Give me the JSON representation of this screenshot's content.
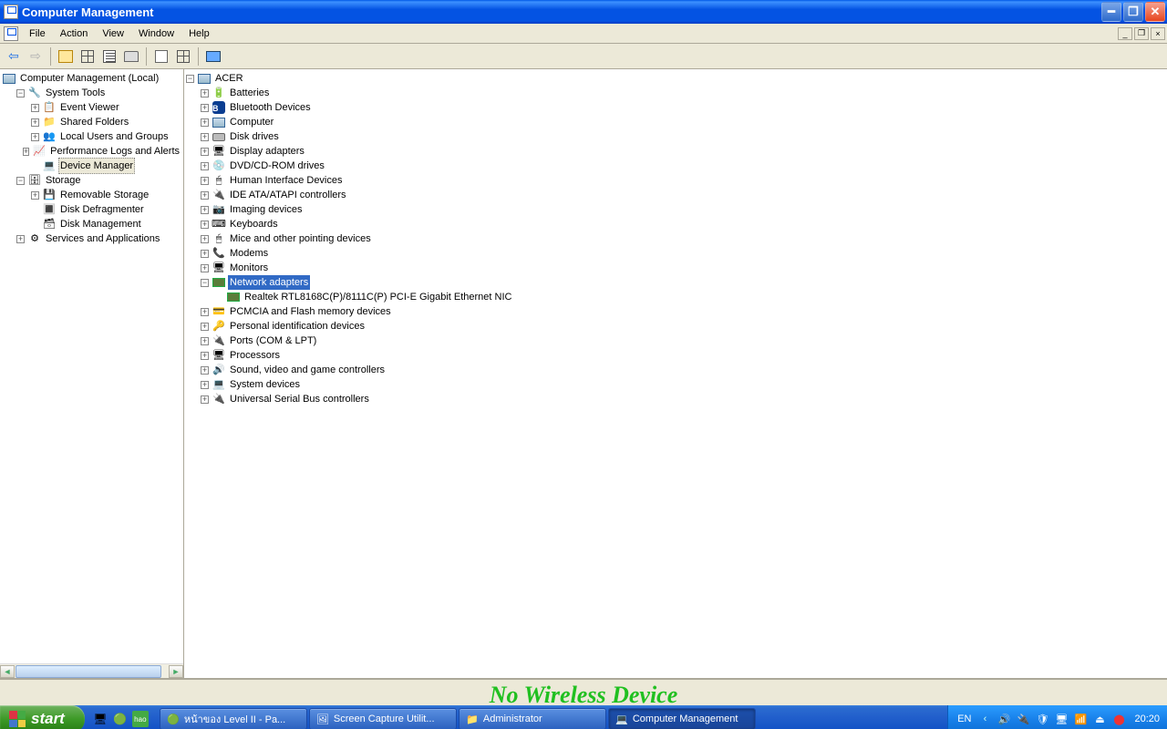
{
  "title": "Computer Management",
  "menu": [
    "File",
    "Action",
    "View",
    "Window",
    "Help"
  ],
  "left_tree": {
    "root": "Computer Management (Local)",
    "system_tools": {
      "label": "System Tools",
      "children": [
        "Event Viewer",
        "Shared Folders",
        "Local Users and Groups",
        "Performance Logs and Alerts",
        "Device Manager"
      ]
    },
    "storage": {
      "label": "Storage",
      "children": [
        "Removable Storage",
        "Disk Defragmenter",
        "Disk Management"
      ]
    },
    "services": "Services and Applications"
  },
  "right_tree": {
    "root": "ACER",
    "categories": [
      "Batteries",
      "Bluetooth Devices",
      "Computer",
      "Disk drives",
      "Display adapters",
      "DVD/CD-ROM drives",
      "Human Interface Devices",
      "IDE ATA/ATAPI controllers",
      "Imaging devices",
      "Keyboards",
      "Mice and other pointing devices",
      "Modems",
      "Monitors"
    ],
    "net_adapters": {
      "label": "Network adapters",
      "child": "Realtek RTL8168C(P)/8111C(P) PCI-E Gigabit Ethernet NIC"
    },
    "categories2": [
      "PCMCIA and Flash memory devices",
      "Personal identification devices",
      "Ports (COM & LPT)",
      "Processors",
      "Sound, video and game controllers",
      "System devices",
      "Universal Serial Bus controllers"
    ]
  },
  "overlay": "No Wireless Device",
  "taskbar": {
    "start": "start",
    "buttons": [
      "หน้าของ Level II - Pa...",
      "Screen Capture Utilit...",
      "Administrator",
      "Computer Management"
    ],
    "lang": "EN",
    "clock": "20:20"
  }
}
